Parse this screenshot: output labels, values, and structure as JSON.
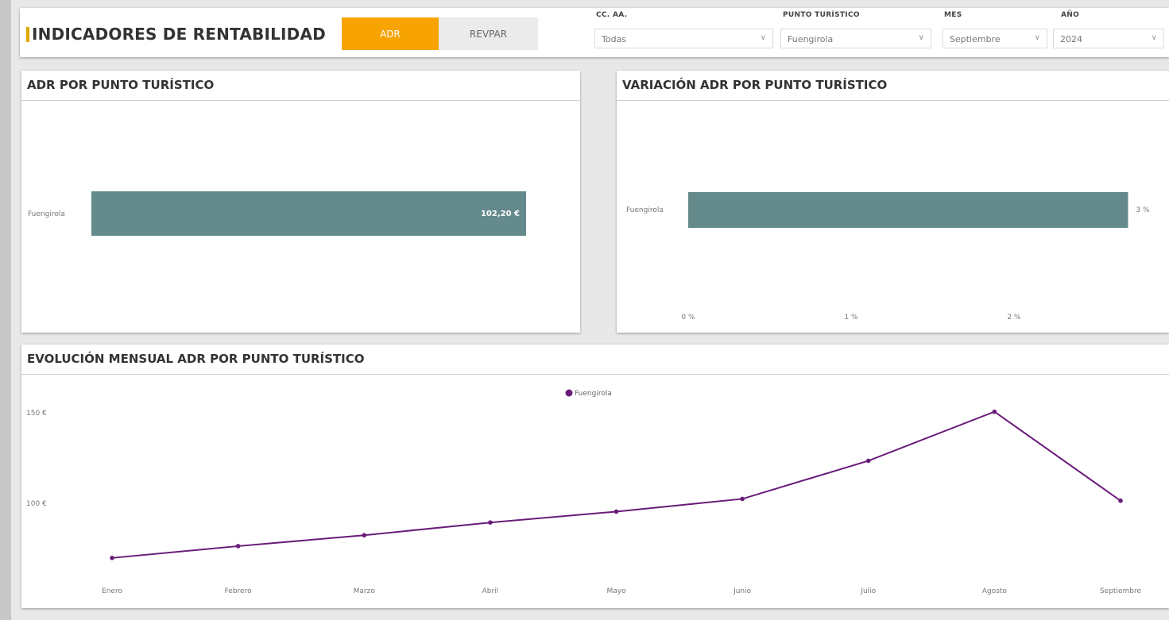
{
  "header": {
    "title": "INDICADORES DE RENTABILIDAD",
    "toggle": {
      "active": "ADR",
      "inactive": "REVPAR"
    },
    "filters": [
      {
        "label": "CC. AA.",
        "value": "Todas"
      },
      {
        "label": "PUNTO TURÍSTICO",
        "value": "Fuengirola"
      },
      {
        "label": "MES",
        "value": "Septiembre"
      },
      {
        "label": "AÑO",
        "value": "2024"
      }
    ],
    "accent_color": "#f7a400",
    "mark_color": "#e0a800"
  },
  "panels": {
    "adr": {
      "title": "ADR POR PUNTO TURÍSTICO"
    },
    "variation": {
      "title": "VARIACIÓN ADR POR PUNTO TURÍSTICO"
    },
    "evolution": {
      "title": "EVOLUCIÓN MENSUAL ADR POR PUNTO TURÍSTICO"
    }
  },
  "chart_data": [
    {
      "type": "bar",
      "orientation": "horizontal",
      "title": "ADR POR PUNTO TURÍSTICO",
      "categories": [
        "Fuengirola"
      ],
      "values": [
        102.2
      ],
      "data_labels": [
        "102,20 €"
      ],
      "color": "#648a8c"
    },
    {
      "type": "bar",
      "orientation": "horizontal",
      "title": "VARIACIÓN ADR POR PUNTO TURÍSTICO",
      "categories": [
        "Fuengirola"
      ],
      "values": [
        2.7
      ],
      "data_labels": [
        "3 %"
      ],
      "x_ticks": [
        "0 %",
        "1 %",
        "2 %"
      ],
      "xlim": [
        0,
        2.7
      ],
      "color": "#648a8c"
    },
    {
      "type": "line",
      "title": "EVOLUCIÓN MENSUAL ADR POR PUNTO TURÍSTICO",
      "categories": [
        "Enero",
        "Febrero",
        "Marzo",
        "Abril",
        "Mayo",
        "Junio",
        "Julio",
        "Agosto",
        "Septiembre"
      ],
      "series": [
        {
          "name": "Fuengirola",
          "values": [
            70,
            76.5,
            82.5,
            89.5,
            95.5,
            102.5,
            123.5,
            150.5,
            101.5
          ]
        }
      ],
      "y_ticks": [
        {
          "value": 100,
          "label": "100 €"
        },
        {
          "value": 150,
          "label": "150 €"
        }
      ],
      "ylim": [
        52,
        170
      ],
      "legend": "top-center",
      "color": "#6a1b7a"
    }
  ]
}
